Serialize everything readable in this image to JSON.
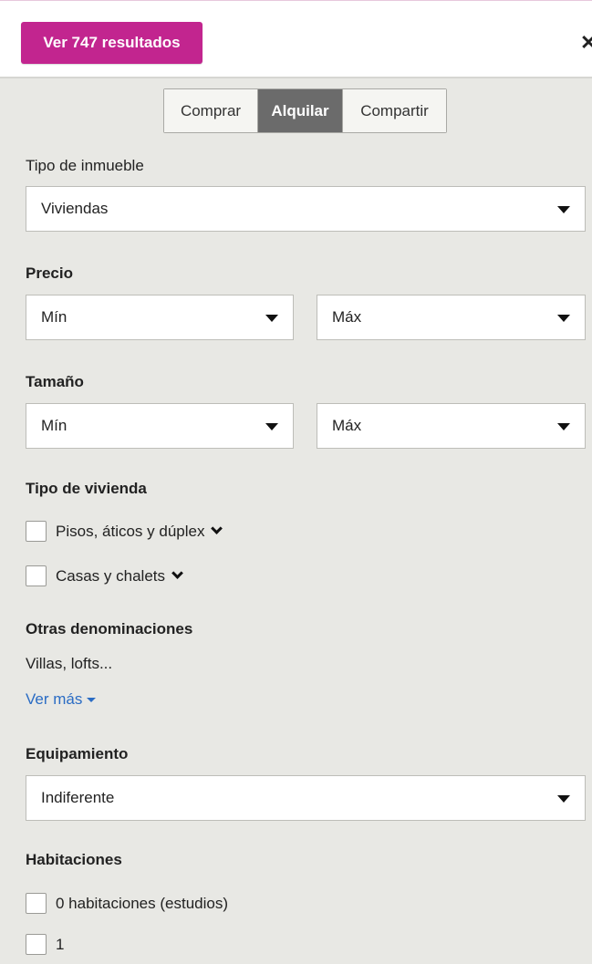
{
  "header": {
    "results_button": "Ver 747 resultados",
    "close_glyph": "✕"
  },
  "operation_tabs": [
    "Comprar",
    "Alquilar",
    "Compartir"
  ],
  "operation_selected": "Alquilar",
  "property_type": {
    "label": "Tipo de inmueble",
    "value": "Viviendas"
  },
  "price": {
    "label": "Precio",
    "min": "Mín",
    "max": "Máx"
  },
  "size": {
    "label": "Tamaño",
    "min": "Mín",
    "max": "Máx"
  },
  "home_type": {
    "label": "Tipo de vivienda",
    "options": [
      "Pisos, áticos y dúplex",
      "Casas y chalets"
    ]
  },
  "other": {
    "label": "Otras denominaciones",
    "text": "Villas, lofts...",
    "link": "Ver más"
  },
  "equipment": {
    "label": "Equipamiento",
    "value": "Indiferente"
  },
  "rooms": {
    "label": "Habitaciones",
    "options": [
      "0 habitaciones (estudios)",
      "1"
    ]
  },
  "colors": {
    "accent": "#c2258f",
    "selected_tab": "#6b6b6b",
    "link": "#2a6cc4",
    "panel_bg": "#e8e8e4"
  }
}
